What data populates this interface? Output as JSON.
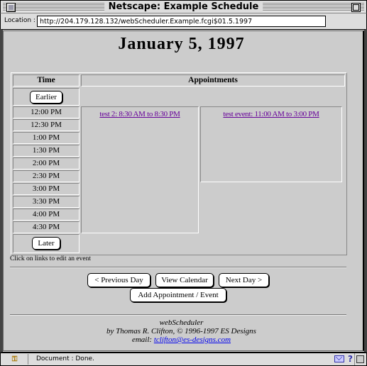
{
  "window": {
    "title": "Netscape: Example Schedule"
  },
  "location": {
    "label": "Location :",
    "url": "http://204.179.128.132/webScheduler.Example.fcgi$01.5.1997"
  },
  "page": {
    "title": "January 5, 1997",
    "headers": {
      "time": "Time",
      "appointments": "Appointments"
    },
    "earlier_label": "Earlier",
    "later_label": "Later",
    "times": [
      "12:00 PM",
      "12:30 PM",
      "1:00 PM",
      "1:30 PM",
      "2:00 PM",
      "2:30 PM",
      "3:00 PM",
      "3:30 PM",
      "4:00 PM",
      "4:30 PM"
    ],
    "appointments": [
      {
        "label": "test 2: 8:30 AM to 8:30 PM",
        "color": "#660099"
      },
      {
        "label": "test event: 11:00 AM to 3:00 PM",
        "color": "#660099"
      }
    ],
    "hint": "Click on links to edit an event",
    "buttons": {
      "previous": "< Previous Day",
      "calendar": "View Calendar",
      "next": "Next Day >",
      "add": "Add Appointment / Event"
    },
    "footer": {
      "app_name": "webScheduler",
      "credit": "by Thomas R. Clifton, © 1996-1997 ES Designs",
      "email_label": "email:",
      "email": "tclifton@es-designs.com"
    }
  },
  "status": {
    "text": "Document : Done."
  }
}
